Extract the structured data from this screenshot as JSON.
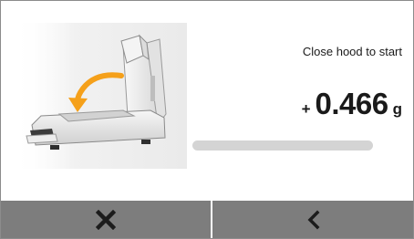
{
  "main": {
    "prompt": "Close hood to start",
    "weight": {
      "sign": "+",
      "value": "0.466",
      "unit": "g"
    },
    "progress": 0,
    "illustration_icon": "balance-hood-close-icon"
  },
  "buttons": {
    "cancel_icon": "close-icon",
    "back_icon": "chevron-left-icon"
  },
  "colors": {
    "arrow": "#f5a01a",
    "button_bg": "#7d7d7d",
    "progress_track": "#d4d4d4"
  }
}
